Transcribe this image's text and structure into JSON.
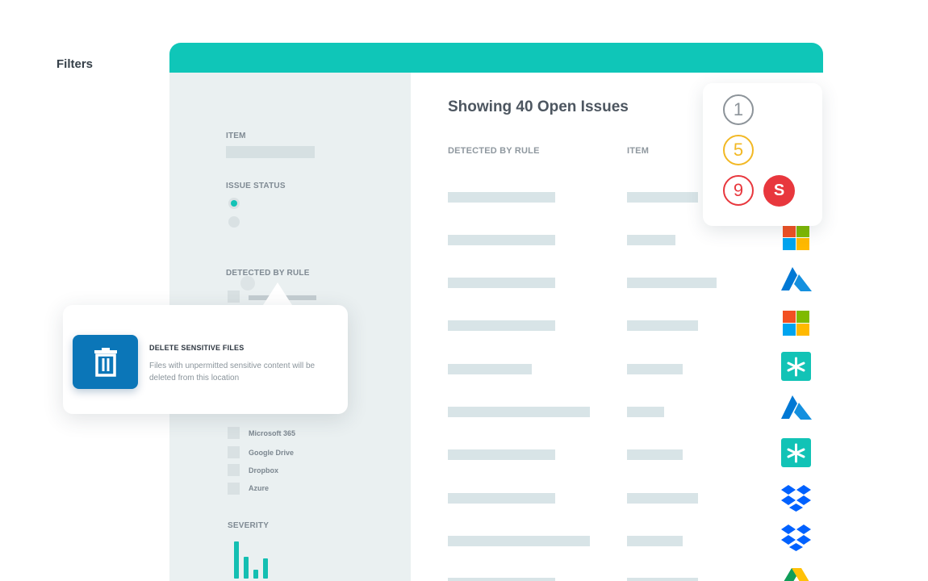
{
  "filters": {
    "title": "Filters",
    "item_label": "ITEM",
    "issue_status_label": "ISSUE STATUS",
    "detected_by_rule_label": "DETECTED BY RULE",
    "sources": [
      "Microsoft 365",
      "Google Drive",
      "Dropbox",
      "Azure"
    ],
    "severity_label": "SEVERITY"
  },
  "main": {
    "title": "Showing 40 Open Issues",
    "columns": [
      "DETECTED BY RULE",
      "ITEM"
    ],
    "service_icons": [
      "microsoft-logo",
      "azure-logo",
      "microsoft-logo",
      "egnyte-logo",
      "azure-logo",
      "egnyte-logo",
      "dropbox-logo",
      "dropbox-logo",
      "google-drive-logo"
    ]
  },
  "scores": [
    {
      "value": "1",
      "color": "#8c9399"
    },
    {
      "value": "5",
      "color": "#f2b824"
    },
    {
      "value": "9",
      "color": "#e8373d"
    }
  ],
  "avatar_letter": "S",
  "popover": {
    "title": "DELETE SENSITIVE FILES",
    "description": "Files with unpermitted sensitive content will be deleted from this location"
  },
  "colors": {
    "accent": "#0fc6b8",
    "trash_button": "#0b76b8"
  }
}
